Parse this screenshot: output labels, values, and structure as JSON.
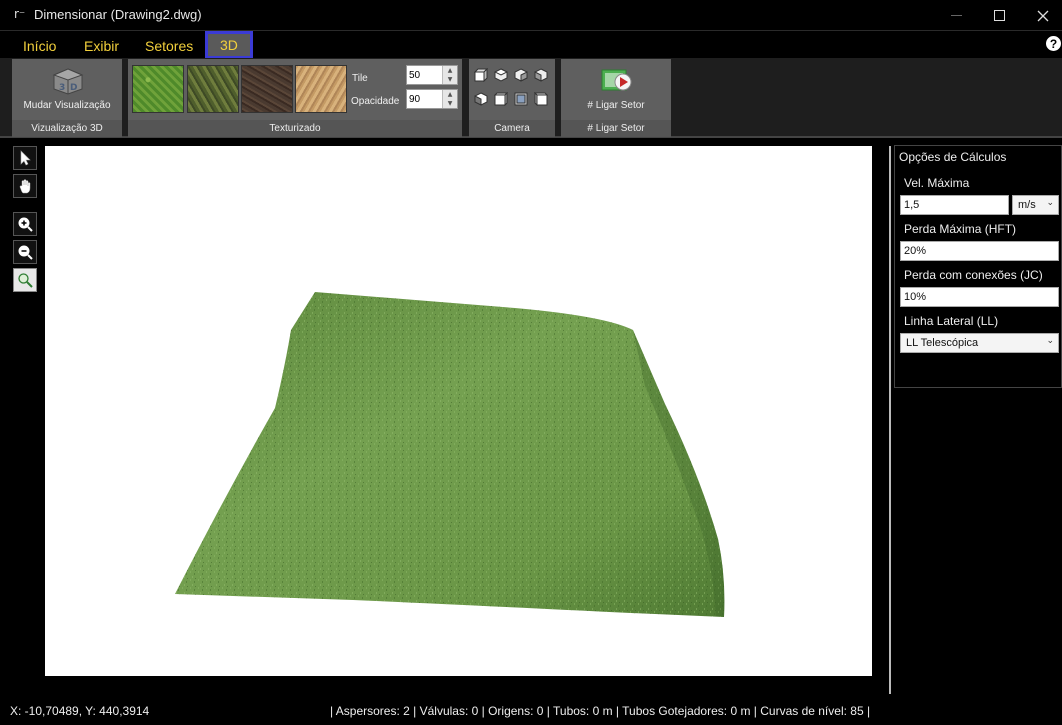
{
  "window": {
    "title": "Dimensionar (Drawing2.dwg)",
    "icon": "app-icon"
  },
  "menu": {
    "tabs": [
      {
        "label": "Início"
      },
      {
        "label": "Exibir"
      },
      {
        "label": "Setores"
      },
      {
        "label": "3D",
        "selected": true
      }
    ],
    "help_icon": "?"
  },
  "ribbon": {
    "visualizacao": {
      "button_label": "Mudar Visualização",
      "group_label": "Vizualização 3D",
      "icon": "3d-cube-icon"
    },
    "texturizado": {
      "group_label": "Texturizado",
      "swatches": [
        "grass-texture",
        "moss-texture",
        "soil-texture",
        "sand-texture"
      ],
      "tile_label": "Tile",
      "tile_value": "50",
      "opacidade_label": "Opacidade",
      "opacidade_value": "90"
    },
    "camera": {
      "group_label": "Camera",
      "buttons": [
        "view-cube-top-left",
        "view-cube-top",
        "view-cube-top-right",
        "view-cube-right",
        "view-cube-left",
        "view-cube-front",
        "view-cube-iso",
        "view-cube-back"
      ]
    },
    "ligar_setor": {
      "button_label": "# Ligar Setor",
      "group_label": "# Ligar Setor",
      "icon": "play-sector-icon"
    }
  },
  "tools": [
    "pointer-icon",
    "hand-pan-icon",
    "zoom-in-icon",
    "zoom-out-icon",
    "zoom-extents-icon"
  ],
  "calc_options": {
    "title": "Opções de Cálculos",
    "vel_label": "Vel. Máxima",
    "vel_value": "1,5",
    "vel_unit": "m/s",
    "hft_label": "Perda Máxima (HFT)",
    "hft_value": "20%",
    "jc_label": "Perda com conexões (JC)",
    "jc_value": "10%",
    "ll_label": "Linha Lateral (LL)",
    "ll_value": "LL Telescópica"
  },
  "status": {
    "coords": "X: -10,70489, Y: 440,3914",
    "counts": "| Aspersores: 2 | Válvulas: 0 | Origens: 0 | Tubos: 0 m | Tubos Gotejadores: 0 m | Curvas de nível: 85 |"
  },
  "colors": {
    "accent_tab_text": "#f2d03c",
    "selected_tab_border": "#3b3bd6",
    "ribbon_group": "#5f5f5f",
    "terrain_green": "#6d9a4a"
  }
}
